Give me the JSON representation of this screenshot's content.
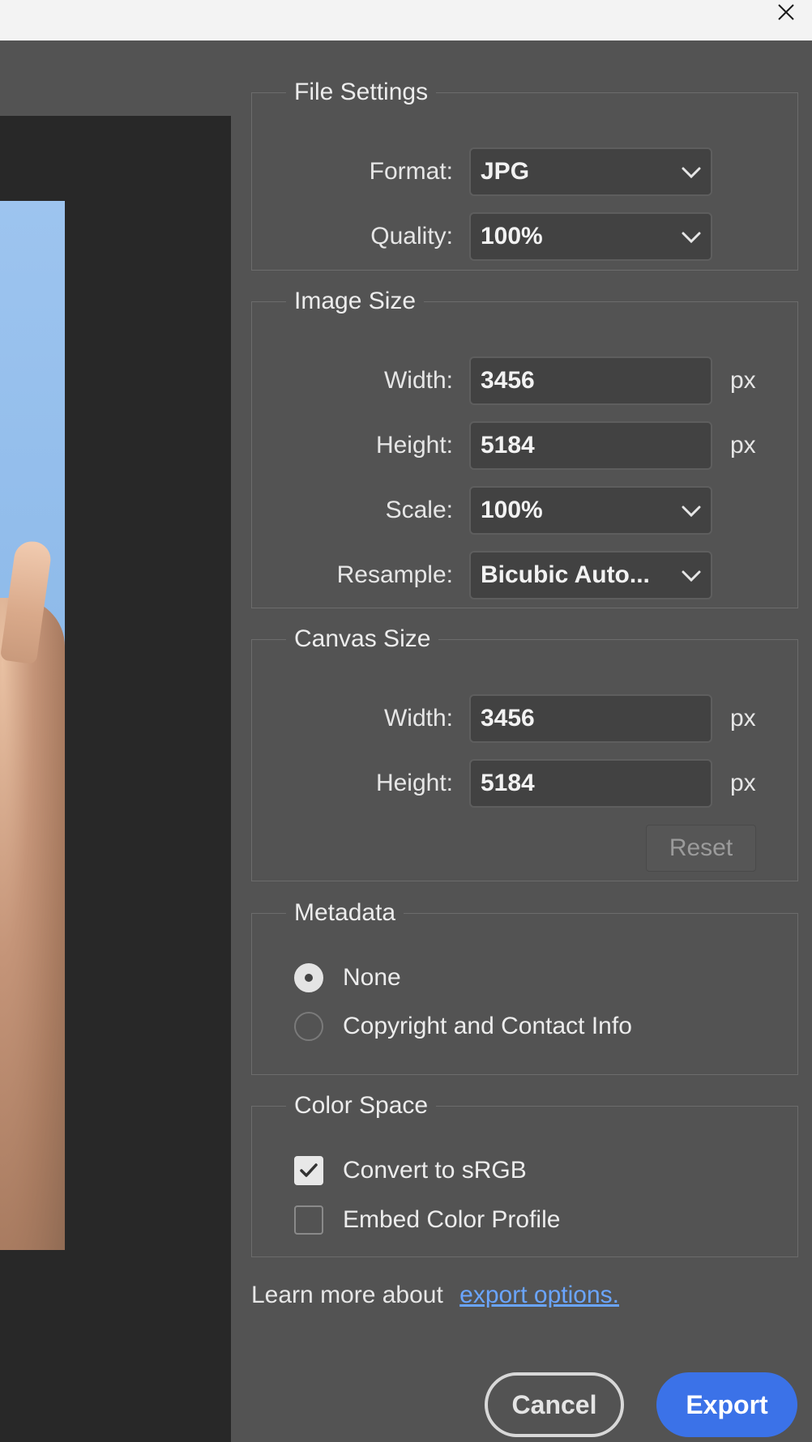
{
  "window": {
    "close_icon": "close-icon"
  },
  "file_settings": {
    "title": "File Settings",
    "format_label": "Format:",
    "format_value": "JPG",
    "quality_label": "Quality:",
    "quality_value": "100%"
  },
  "image_size": {
    "title": "Image Size",
    "width_label": "Width:",
    "width_value": "3456",
    "height_label": "Height:",
    "height_value": "5184",
    "unit": "px",
    "scale_label": "Scale:",
    "scale_value": "100%",
    "resample_label": "Resample:",
    "resample_value": "Bicubic Auto..."
  },
  "canvas_size": {
    "title": "Canvas Size",
    "width_label": "Width:",
    "width_value": "3456",
    "height_label": "Height:",
    "height_value": "5184",
    "unit": "px",
    "reset_label": "Reset"
  },
  "metadata": {
    "title": "Metadata",
    "options": [
      {
        "label": "None",
        "selected": true
      },
      {
        "label": "Copyright and Contact Info",
        "selected": false
      }
    ]
  },
  "color_space": {
    "title": "Color Space",
    "options": [
      {
        "label": "Convert to sRGB",
        "checked": true
      },
      {
        "label": "Embed Color Profile",
        "checked": false
      }
    ]
  },
  "footer": {
    "learn_text": "Learn more about",
    "learn_link": "export options.",
    "cancel_label": "Cancel",
    "export_label": "Export"
  },
  "colors": {
    "panel_bg": "#535353",
    "preview_bg": "#282828",
    "accent": "#3b72e8",
    "link": "#6aa5ff"
  }
}
